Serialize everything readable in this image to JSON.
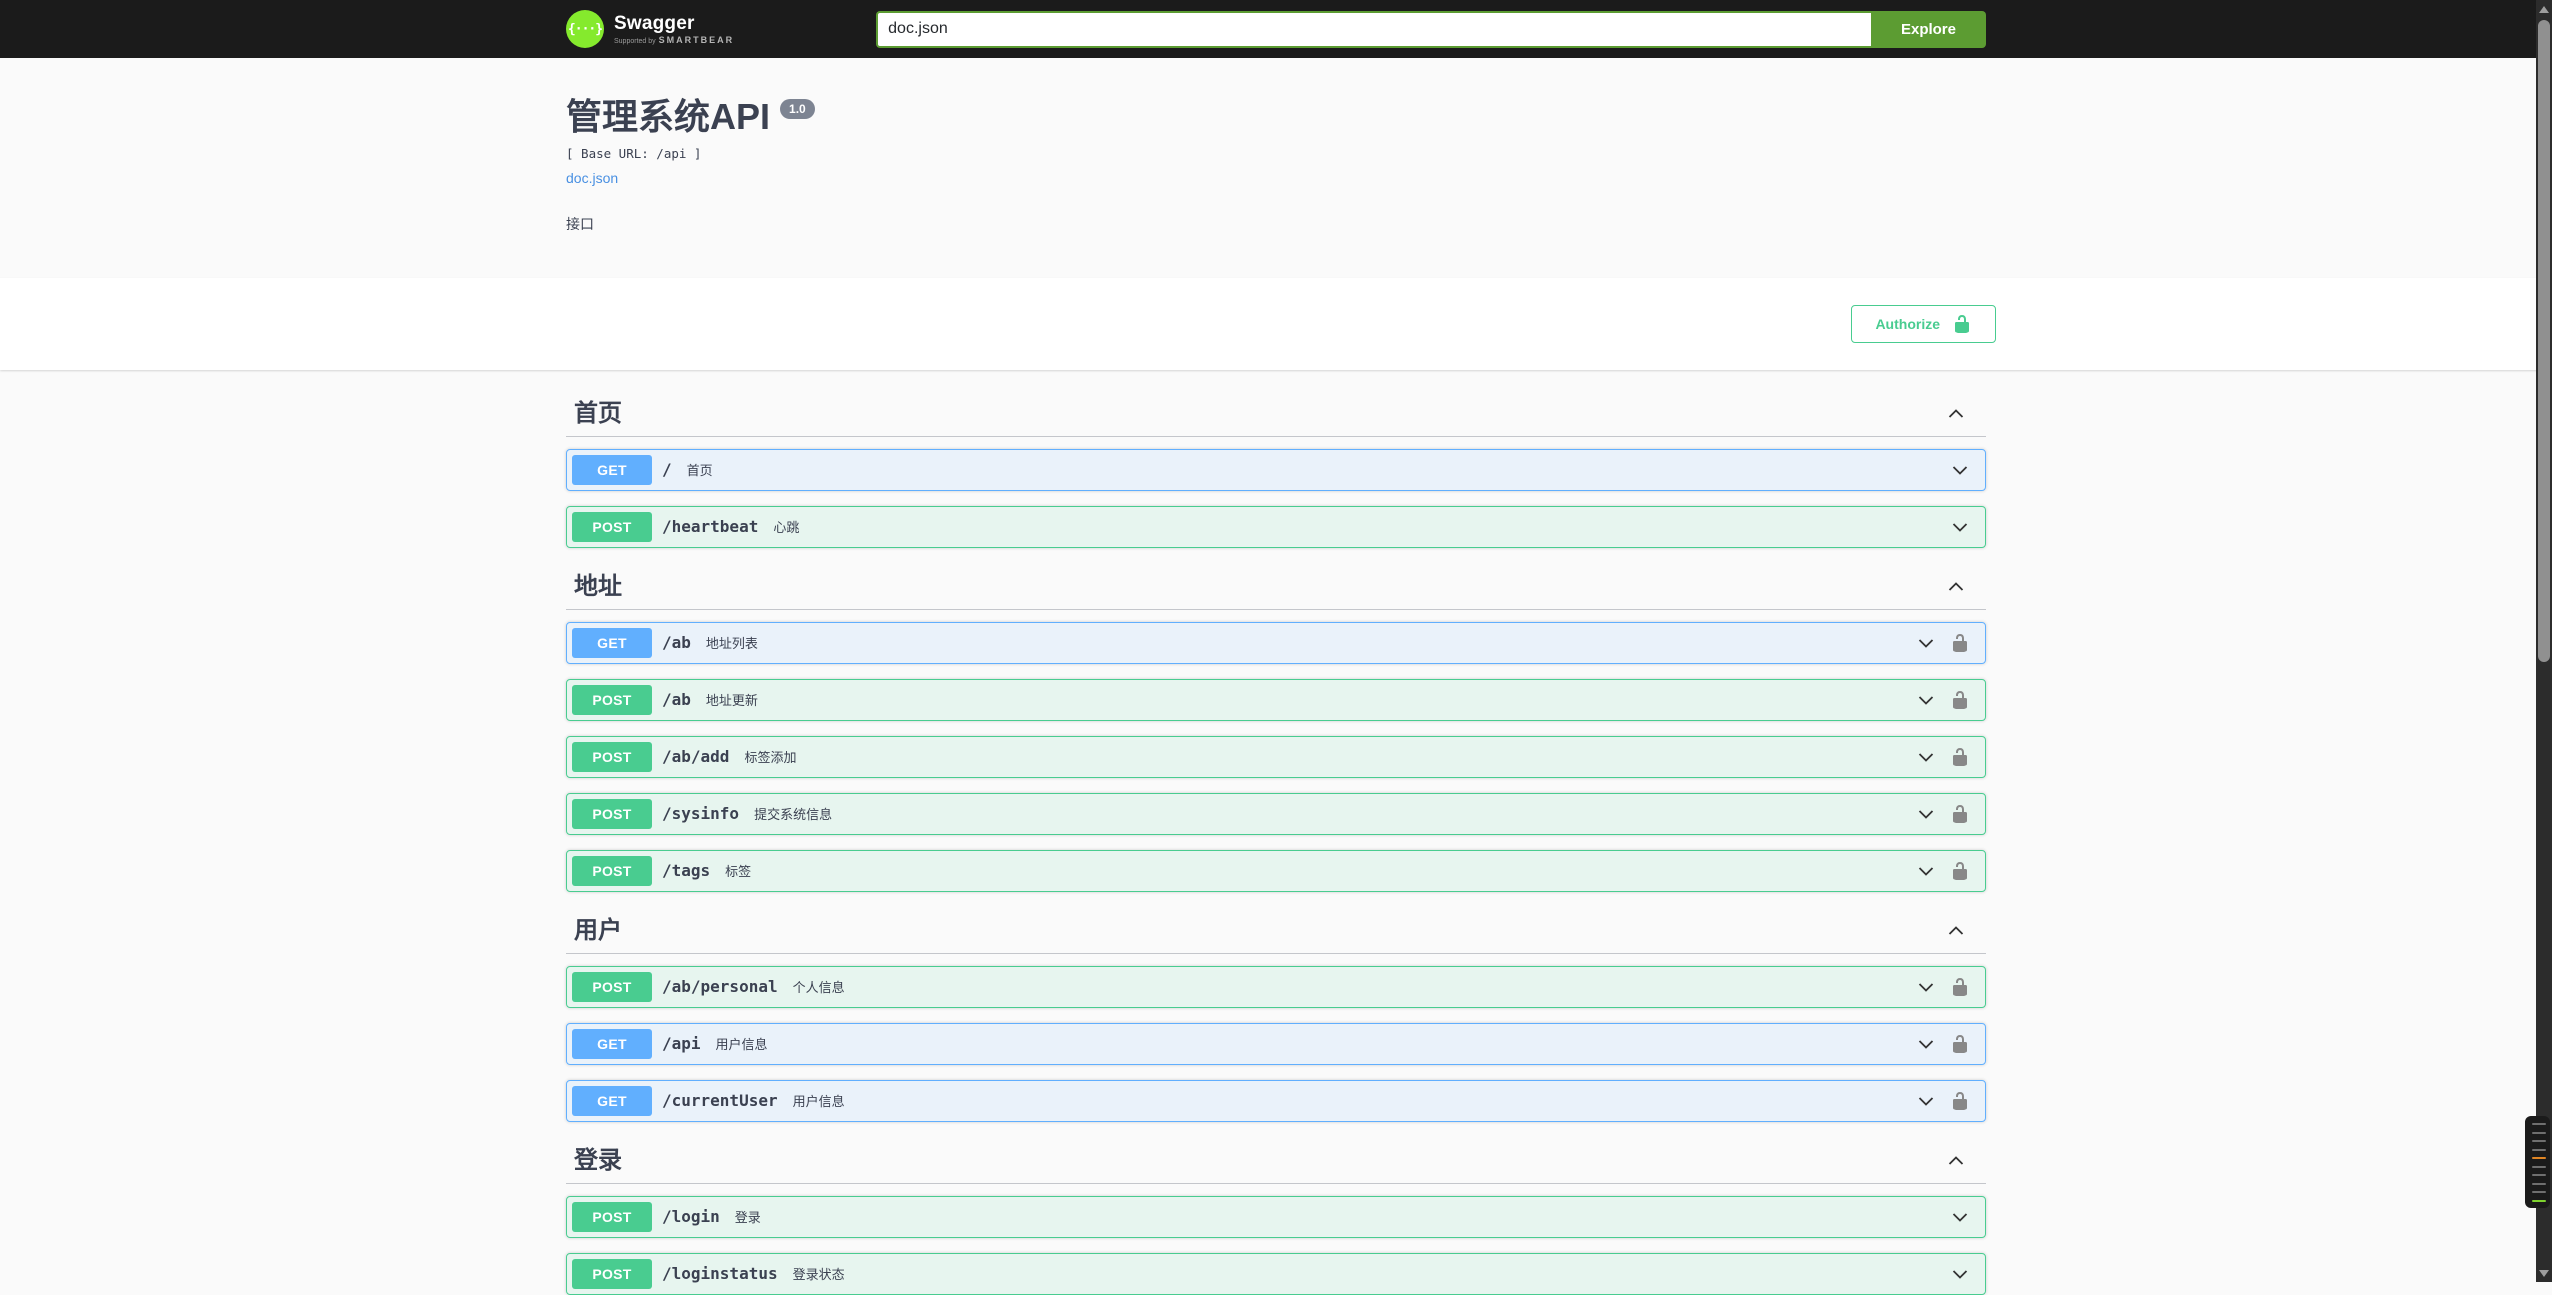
{
  "topbar": {
    "logo_text": "Swagger",
    "logo_glyph": "{···}",
    "logo_tagline_prefix": "Supported by",
    "logo_tagline_brand": "SMARTBEAR",
    "search_value": "doc.json",
    "explore_label": "Explore"
  },
  "info": {
    "title": "管理系统API",
    "version": "1.0",
    "base_url": "[ Base URL: /api ]",
    "spec_link": "doc.json",
    "description": "接口"
  },
  "auth": {
    "authorize_label": "Authorize"
  },
  "sections": [
    {
      "title": "首页",
      "operations": [
        {
          "method": "GET",
          "path": "/",
          "summary": "首页",
          "locked": false
        },
        {
          "method": "POST",
          "path": "/heartbeat",
          "summary": "心跳",
          "locked": false
        }
      ]
    },
    {
      "title": "地址",
      "operations": [
        {
          "method": "GET",
          "path": "/ab",
          "summary": "地址列表",
          "locked": true
        },
        {
          "method": "POST",
          "path": "/ab",
          "summary": "地址更新",
          "locked": true
        },
        {
          "method": "POST",
          "path": "/ab/add",
          "summary": "标签添加",
          "locked": true
        },
        {
          "method": "POST",
          "path": "/sysinfo",
          "summary": "提交系统信息",
          "locked": true
        },
        {
          "method": "POST",
          "path": "/tags",
          "summary": "标签",
          "locked": true
        }
      ]
    },
    {
      "title": "用户",
      "operations": [
        {
          "method": "POST",
          "path": "/ab/personal",
          "summary": "个人信息",
          "locked": true
        },
        {
          "method": "GET",
          "path": "/api",
          "summary": "用户信息",
          "locked": true
        },
        {
          "method": "GET",
          "path": "/currentUser",
          "summary": "用户信息",
          "locked": true
        }
      ]
    },
    {
      "title": "登录",
      "operations": [
        {
          "method": "POST",
          "path": "/login",
          "summary": "登录",
          "locked": false
        },
        {
          "method": "POST",
          "path": "/loginstatus",
          "summary": "登录状态",
          "locked": false
        }
      ]
    }
  ],
  "colors": {
    "get": "#61affe",
    "post": "#49cc90",
    "topbar_bg": "#1b1b1b",
    "button_green": "#5c9c32",
    "authorize_green": "#49cc90",
    "link_blue": "#4990e2",
    "version_badge_gray": "#7d8492"
  },
  "scrollbar": {
    "minimap_lines": [
      "#6f6f6f",
      "#6f6f6f",
      "#6f6f6f",
      "#6f6f6f",
      "#e08524",
      "#6f6f6f",
      "#6f6f6f",
      "#6f6f6f",
      "#6f6f6f",
      "#7fd32f"
    ]
  }
}
